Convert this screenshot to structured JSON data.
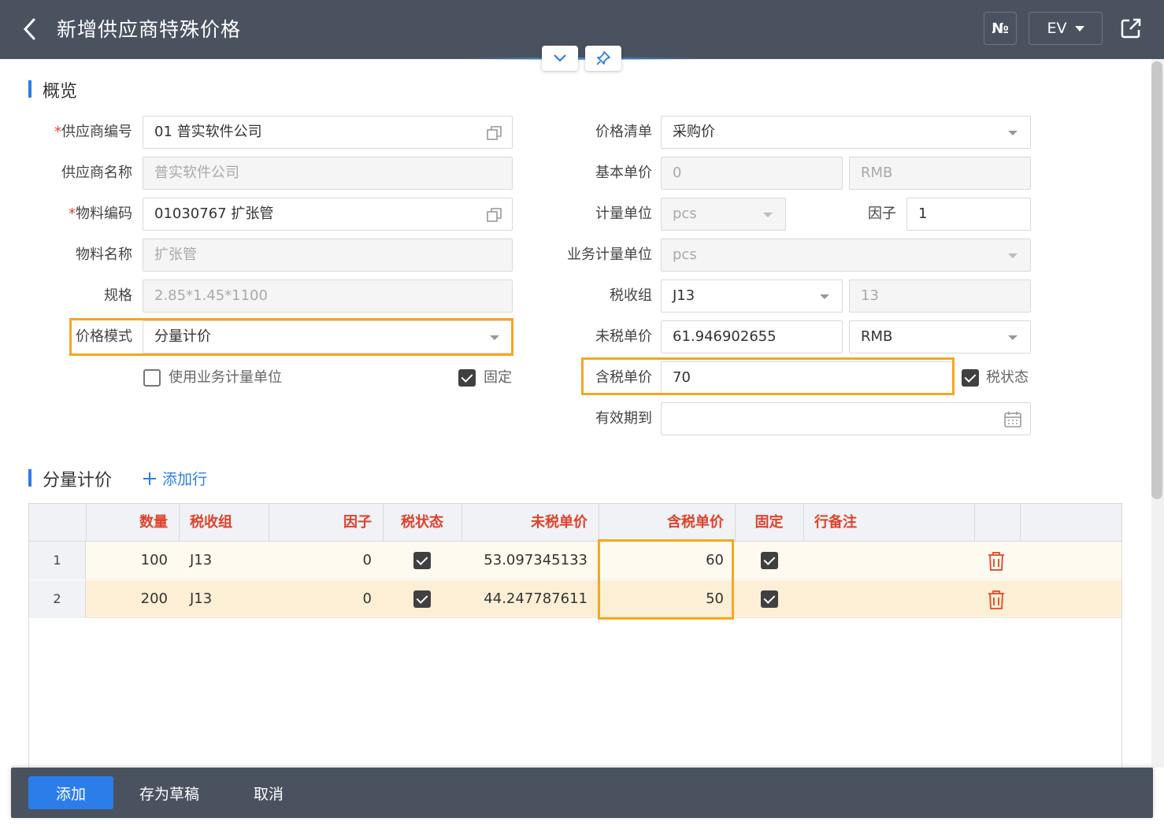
{
  "header": {
    "title": "新增供应商特殊价格",
    "no_label": "№",
    "ev_label": "EV"
  },
  "overview": {
    "title": "概览",
    "left": {
      "supplier_code": {
        "label": "供应商编号",
        "required": "*",
        "value": "01 普实软件公司"
      },
      "supplier_name": {
        "label": "供应商名称",
        "value": "普实软件公司"
      },
      "material_code": {
        "label": "物料编码",
        "required": "*",
        "value": "01030767 扩张管"
      },
      "material_name": {
        "label": "物料名称",
        "value": "扩张管"
      },
      "spec": {
        "label": "规格",
        "value": "2.85*1.45*1100"
      },
      "price_mode": {
        "label": "价格模式",
        "value": "分量计价"
      },
      "use_biz_unit": {
        "label": "使用业务计量单位",
        "checked": false
      },
      "fixed": {
        "label": "固定",
        "checked": true
      }
    },
    "right": {
      "price_list": {
        "label": "价格清单",
        "value": "采购价"
      },
      "base_price": {
        "label": "基本单价",
        "value": "0",
        "currency": "RMB"
      },
      "unit": {
        "label": "计量单位",
        "value": "pcs",
        "factor_label": "因子",
        "factor_value": "1"
      },
      "biz_unit": {
        "label": "业务计量单位",
        "value": "pcs"
      },
      "tax_group": {
        "label": "税收组",
        "value": "J13",
        "rate": "13"
      },
      "net_price": {
        "label": "未税单价",
        "value": "61.946902655",
        "currency": "RMB"
      },
      "gross_price": {
        "label": "含税单价",
        "value": "70"
      },
      "tax_status": {
        "label": "税状态",
        "checked": true
      },
      "valid_until": {
        "label": "有效期到",
        "value": ""
      }
    }
  },
  "tiered": {
    "title": "分量计价",
    "add_row_label": "添加行",
    "columns": {
      "qty": "数量",
      "tax_group": "税收组",
      "factor": "因子",
      "tax_status": "税状态",
      "net_price": "未税单价",
      "gross_price": "含税单价",
      "fixed": "固定",
      "remark": "行备注"
    },
    "rows": [
      {
        "num": "1",
        "qty": "100",
        "tax_group": "J13",
        "factor": "0",
        "tax_status": true,
        "net_price": "53.097345133",
        "gross_price": "60",
        "fixed": true,
        "remark": ""
      },
      {
        "num": "2",
        "qty": "200",
        "tax_group": "J13",
        "factor": "0",
        "tax_status": true,
        "net_price": "44.247787611",
        "gross_price": "50",
        "fixed": true,
        "remark": ""
      }
    ]
  },
  "footer": {
    "add_label": "添加",
    "draft_label": "存为草稿",
    "cancel_label": "取消"
  },
  "colors": {
    "header_bg": "#4a5260",
    "accent": "#2b7de9",
    "highlight": "#f5a623",
    "column_header": "#e0412b",
    "delete": "#e8553a"
  }
}
